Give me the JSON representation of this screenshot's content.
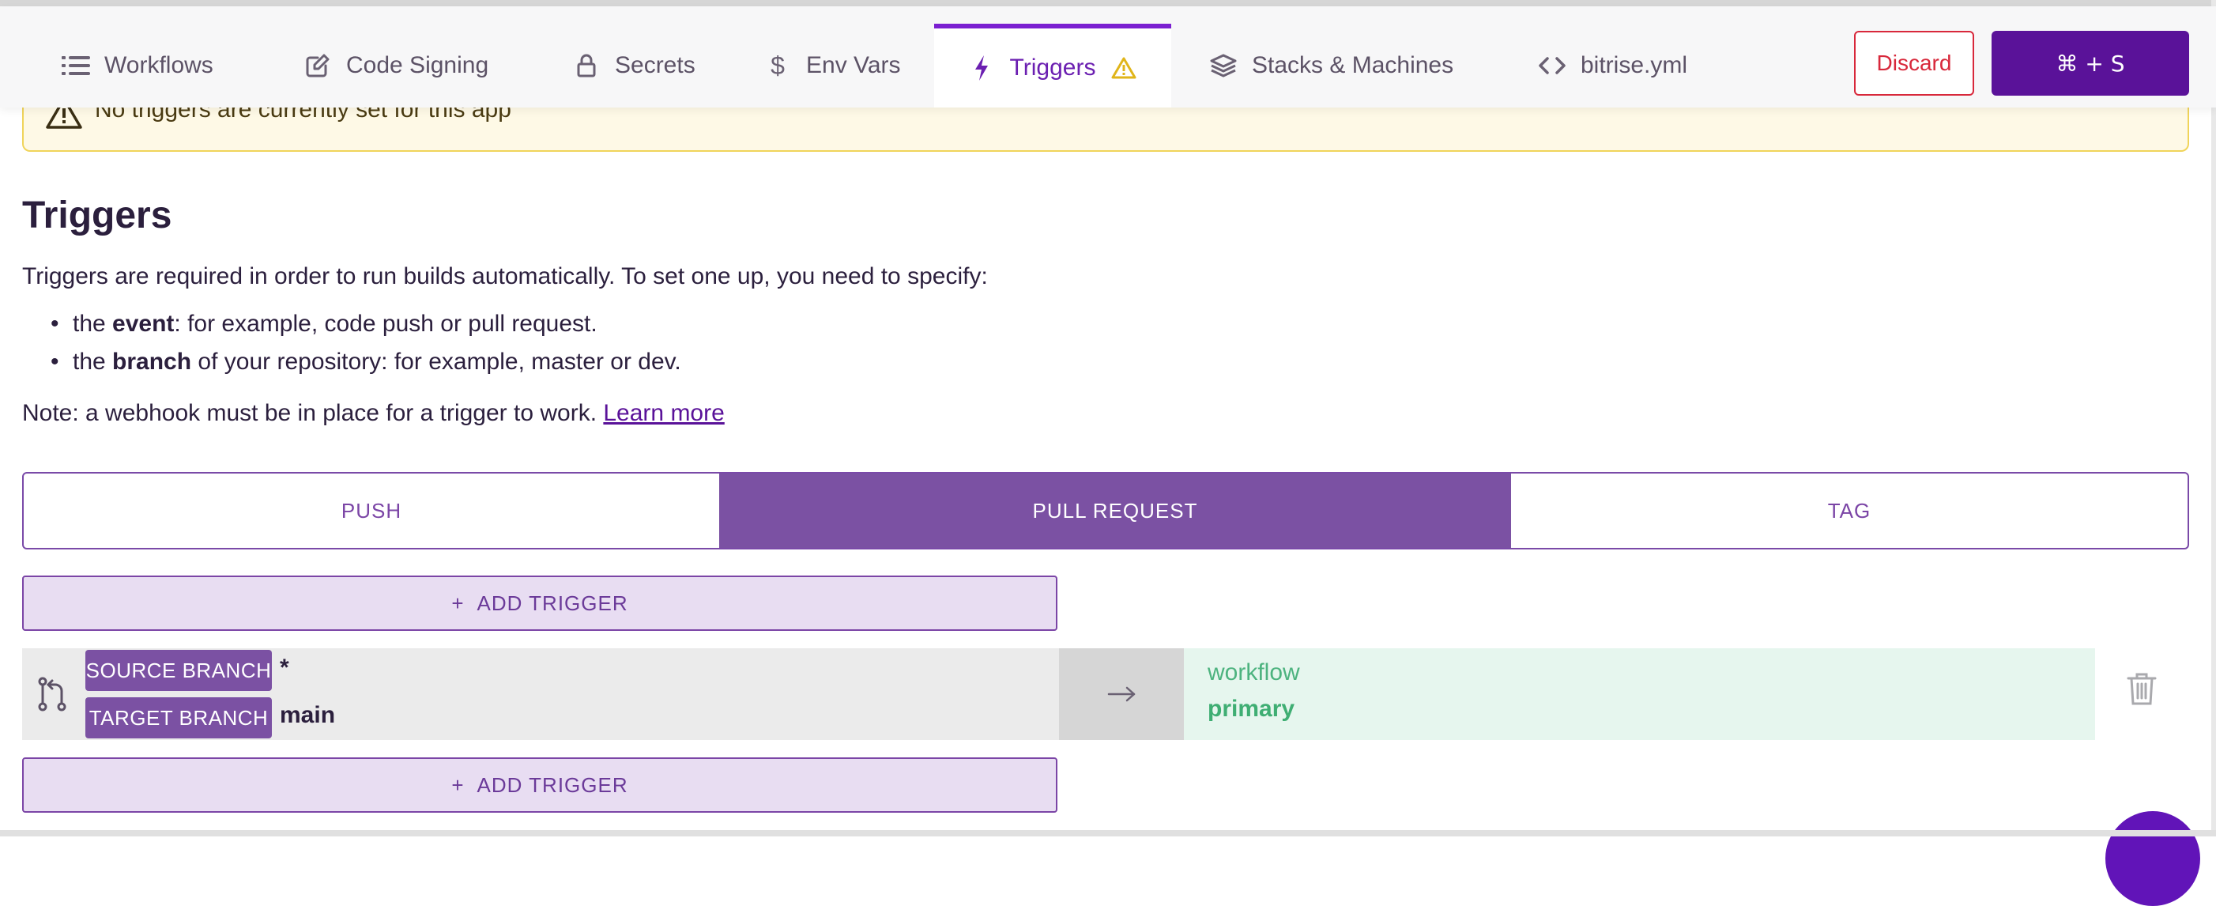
{
  "nav": {
    "tabs": [
      {
        "label": "Workflows",
        "icon": "list-icon"
      },
      {
        "label": "Code Signing",
        "icon": "edit-icon"
      },
      {
        "label": "Secrets",
        "icon": "lock-icon"
      },
      {
        "label": "Env Vars",
        "icon": "dollar-icon"
      },
      {
        "label": "Triggers",
        "icon": "bolt-icon",
        "active": true,
        "warning_icon": "warning-icon"
      },
      {
        "label": "Stacks & Machines",
        "icon": "layers-icon"
      },
      {
        "label": "bitrise.yml",
        "icon": "code-icon"
      }
    ],
    "discard_label": "Discard",
    "save_label": "⌘ + S"
  },
  "warning": {
    "text": "No triggers are currently set for this app",
    "icon": "warning-icon"
  },
  "content": {
    "title": "Triggers",
    "intro": "Triggers are required in order to run builds automatically. To set one up, you need to specify:",
    "bullets": [
      {
        "prefix": "the ",
        "bold": "event",
        "rest": ": for example, code push or pull request."
      },
      {
        "prefix": "the ",
        "bold": "branch",
        "rest": " of your repository: for example, master or dev."
      }
    ],
    "note": "Note: a webhook must be in place for a trigger to work.",
    "learn_more": "Learn more"
  },
  "trigger_types": {
    "push": "PUSH",
    "pull_request": "PULL REQUEST",
    "tag": "TAG",
    "selected": "PULL REQUEST"
  },
  "add_trigger": {
    "plus": "+",
    "label": "ADD TRIGGER"
  },
  "trigger": {
    "source_label": "SOURCE BRANCH",
    "source_value": "*",
    "target_label": "TARGET BRANCH",
    "target_value": "main",
    "arrow": "→",
    "workflow_label": "workflow",
    "workflow_name": "primary"
  },
  "colors": {
    "accent": "#5a1299",
    "active_tab": "#7b1fd1",
    "segment_selected": "#7b51a3",
    "danger": "#d8283b",
    "warning_bg": "#fef9e6",
    "workflow_green": "#3fae73"
  }
}
